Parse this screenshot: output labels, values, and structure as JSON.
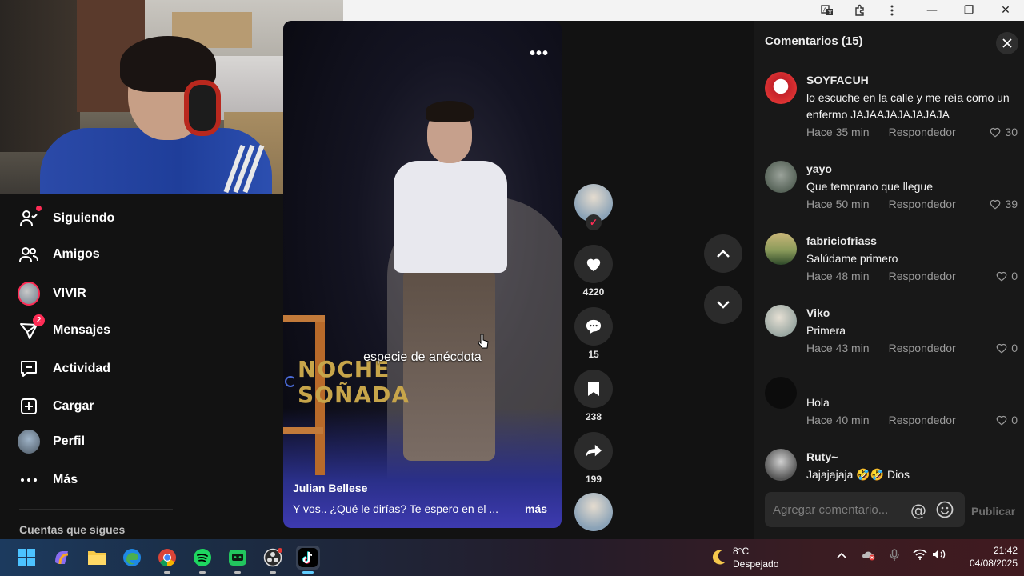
{
  "browser": {
    "minimize": "—",
    "restore": "❐",
    "close": "✕"
  },
  "sidebar": {
    "items": [
      {
        "label": "Siguiendo",
        "icon": "following-icon"
      },
      {
        "label": "Amigos",
        "icon": "friends-icon"
      },
      {
        "label": "VIVIR",
        "icon": "live-avatar"
      },
      {
        "label": "Mensajes",
        "icon": "messages-icon",
        "badge": "2"
      },
      {
        "label": "Actividad",
        "icon": "activity-icon"
      },
      {
        "label": "Cargar",
        "icon": "upload-icon"
      },
      {
        "label": "Perfil",
        "icon": "profile-avatar"
      },
      {
        "label": "Más",
        "icon": "more-icon"
      }
    ],
    "following_accounts_label": "Cuentas que sigues"
  },
  "video": {
    "overlay_title_line1": "NOCHE",
    "overlay_title_line2": "SOÑADA",
    "caption": "especie de anécdota",
    "author": "Julian Bellese",
    "description": "Y vos.. ¿Qué le dirías? Te espero en el ...",
    "more_label": "más"
  },
  "actions": {
    "likes": "4220",
    "comments": "15",
    "saves": "238",
    "shares": "199"
  },
  "comments_panel": {
    "title": "Comentarios (15)",
    "input_placeholder": "Agregar comentario...",
    "publish_label": "Publicar",
    "items": [
      {
        "user": "SOYFACUH",
        "text": "lo escuche en la calle y me reía como un enfermo JAJAAJAJAJAJAJA",
        "time": "Hace 35 min",
        "reply": "Respondedor",
        "likes": "30"
      },
      {
        "user": "yayo",
        "text": "Que temprano que llegue",
        "time": "Hace 50 min",
        "reply": "Respondedor",
        "likes": "39"
      },
      {
        "user": "fabriciofriass",
        "text": "Salúdame primero",
        "time": "Hace 48 min",
        "reply": "Respondedor",
        "likes": "0"
      },
      {
        "user": "Viko",
        "text": "Primera",
        "time": "Hace 43 min",
        "reply": "Respondedor",
        "likes": "0"
      },
      {
        "user": "",
        "text": "Hola",
        "time": "Hace 40 min",
        "reply": "Respondedor",
        "likes": "0"
      },
      {
        "user": "Ruty~",
        "text": "Jajajajaja 🤣🤣 Dios",
        "time": "",
        "reply": "",
        "likes": ""
      }
    ]
  },
  "taskbar": {
    "weather_temp": "8°C",
    "weather_condition": "Despejado",
    "time": "21:42",
    "date": "04/08/2025"
  },
  "colors": {
    "accent": "#fe2c55",
    "panel_bg": "#181818",
    "page_bg": "#121212"
  }
}
